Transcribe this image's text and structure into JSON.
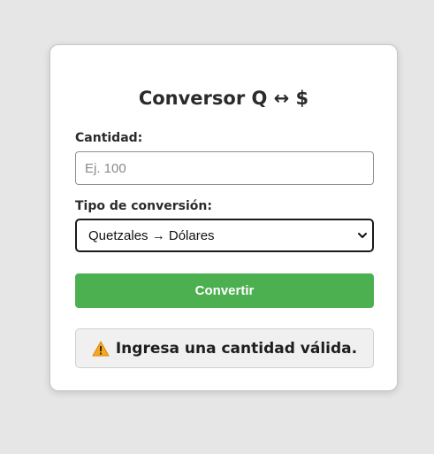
{
  "card": {
    "title": "Conversor Q ↔ $",
    "quantity_label": "Cantidad:",
    "quantity_input": {
      "value": "",
      "placeholder": "Ej. 100"
    },
    "conversion_label": "Tipo de conversión:",
    "conversion_select": {
      "selected": "Quetzales → Dólares"
    },
    "convert_button": "Convertir",
    "message": {
      "icon": "warning-icon",
      "text": "Ingresa una cantidad válida."
    }
  },
  "colors": {
    "background": "#e6e6e6",
    "card": "#ffffff",
    "button": "#4caf50",
    "button_text": "#ffffff",
    "message_bg": "#f0f0f0",
    "warning": "#f5a623"
  }
}
